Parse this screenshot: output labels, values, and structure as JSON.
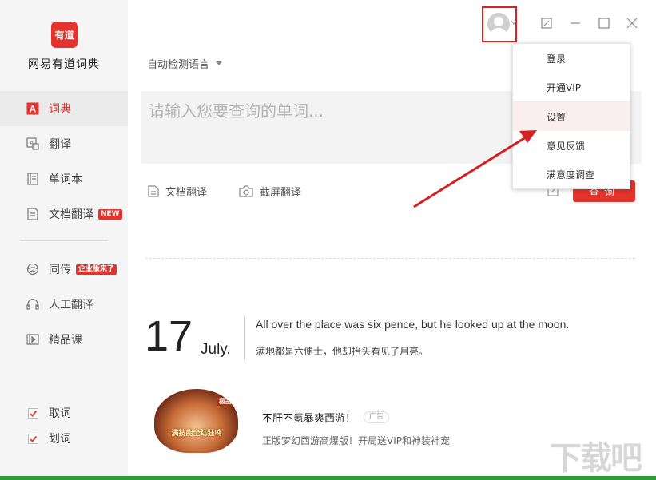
{
  "app": {
    "logo_text": "有道",
    "name": "网易有道词典"
  },
  "sidebar": {
    "items": [
      {
        "label": "词典",
        "icon": "dictionary-icon",
        "active": true
      },
      {
        "label": "翻译",
        "icon": "translate-icon"
      },
      {
        "label": "单词本",
        "icon": "wordbook-icon"
      },
      {
        "label": "文档翻译",
        "icon": "document-icon",
        "badge": "NEW"
      },
      {
        "label": "同传",
        "icon": "simultaneous-icon",
        "badge": "企业版来了"
      },
      {
        "label": "人工翻译",
        "icon": "human-translate-icon"
      },
      {
        "label": "精品课",
        "icon": "course-icon"
      }
    ],
    "checks": [
      {
        "label": "取词",
        "checked": true
      },
      {
        "label": "划词",
        "checked": true
      }
    ]
  },
  "header": {
    "language_select": "自动检测语言"
  },
  "search": {
    "placeholder": "请输入您要查询的单词..."
  },
  "tools": {
    "doc_translate": "文档翻译",
    "screenshot_translate": "截屏翻译",
    "query_button": "查询"
  },
  "daily": {
    "day": "17",
    "month": "July.",
    "sentence_en": "All over the place was six pence, but he looked up at the moon.",
    "sentence_cn": "满地都是六便士，他却抬头看见了月亮。"
  },
  "ad": {
    "image_text": "满技能全红狂鸣",
    "image_corner": "极品",
    "title": "不肝不氪暴爽西游！",
    "tag": "广告",
    "description": "正版梦幻西游高爆版！开局送VIP和神装神宠"
  },
  "user_menu": {
    "items": [
      "登录",
      "开通VIP",
      "设置",
      "意见反馈",
      "满意度调查"
    ],
    "highlighted": "设置"
  },
  "colors": {
    "brand_red": "#e4322c",
    "annotation_red": "#e02020"
  }
}
